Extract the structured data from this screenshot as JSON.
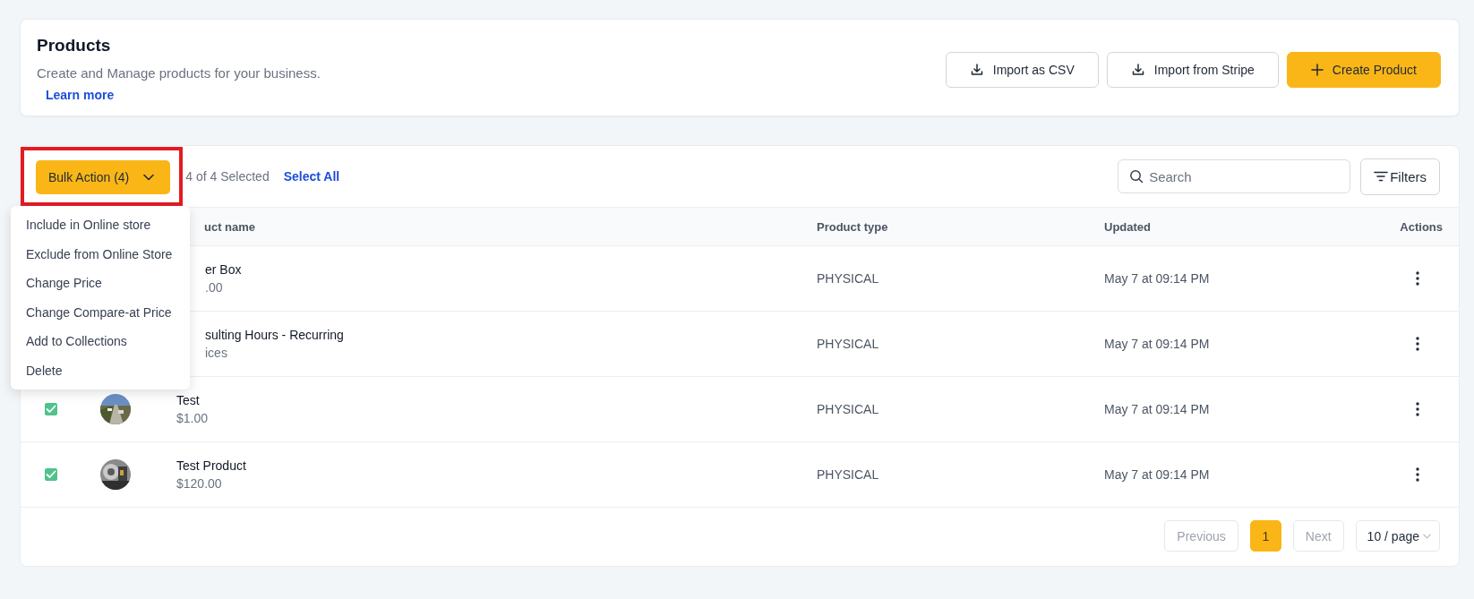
{
  "header": {
    "title": "Products",
    "subtitle": "Create and Manage products for your business.",
    "link": "Learn more",
    "buttons": [
      {
        "label": "Import as CSV",
        "kind": "import"
      },
      {
        "label": "Import from Stripe",
        "kind": "import"
      },
      {
        "label": "Create Product",
        "kind": "create"
      }
    ]
  },
  "toolbar": {
    "bulk_action": "Bulk Action (4)",
    "highlighted": true,
    "selection": "4 of 4 Selected",
    "select_all": "Select All",
    "search": {
      "placeholder": "Search"
    },
    "filters": "Filters"
  },
  "menu": {
    "items": [
      "Include in Online store",
      "Exclude from Online Store",
      "Change Price",
      "Change Compare-at Price",
      "Add to Collections",
      "Delete"
    ]
  },
  "table": {
    "columns": [
      "uct name",
      "Product type",
      "Updated",
      "Actions"
    ],
    "rows": [
      {
        "name": "er Box",
        "price": ".00",
        "type": "PHYSICAL",
        "updated": "May 7 at 09:14 PM"
      },
      {
        "name": "sulting Hours - Recurring",
        "price": "ices",
        "type": "PHYSICAL",
        "updated": "May 7 at 09:14 PM"
      },
      {
        "checked": true,
        "name": "Test",
        "price": "$1.00",
        "type": "PHYSICAL",
        "updated": "May 7 at 09:14 PM"
      },
      {
        "checked": true,
        "name": "Test Product",
        "price": "$120.00",
        "type": "PHYSICAL",
        "updated": "May 7 at 09:14 PM"
      }
    ]
  },
  "pagination": {
    "previous": {
      "label": "Previous",
      "disabled": true
    },
    "pages": [
      {
        "label": "1",
        "selected": true
      }
    ],
    "next": {
      "label": "Next",
      "disabled": true
    },
    "page_size": "10 / page"
  }
}
